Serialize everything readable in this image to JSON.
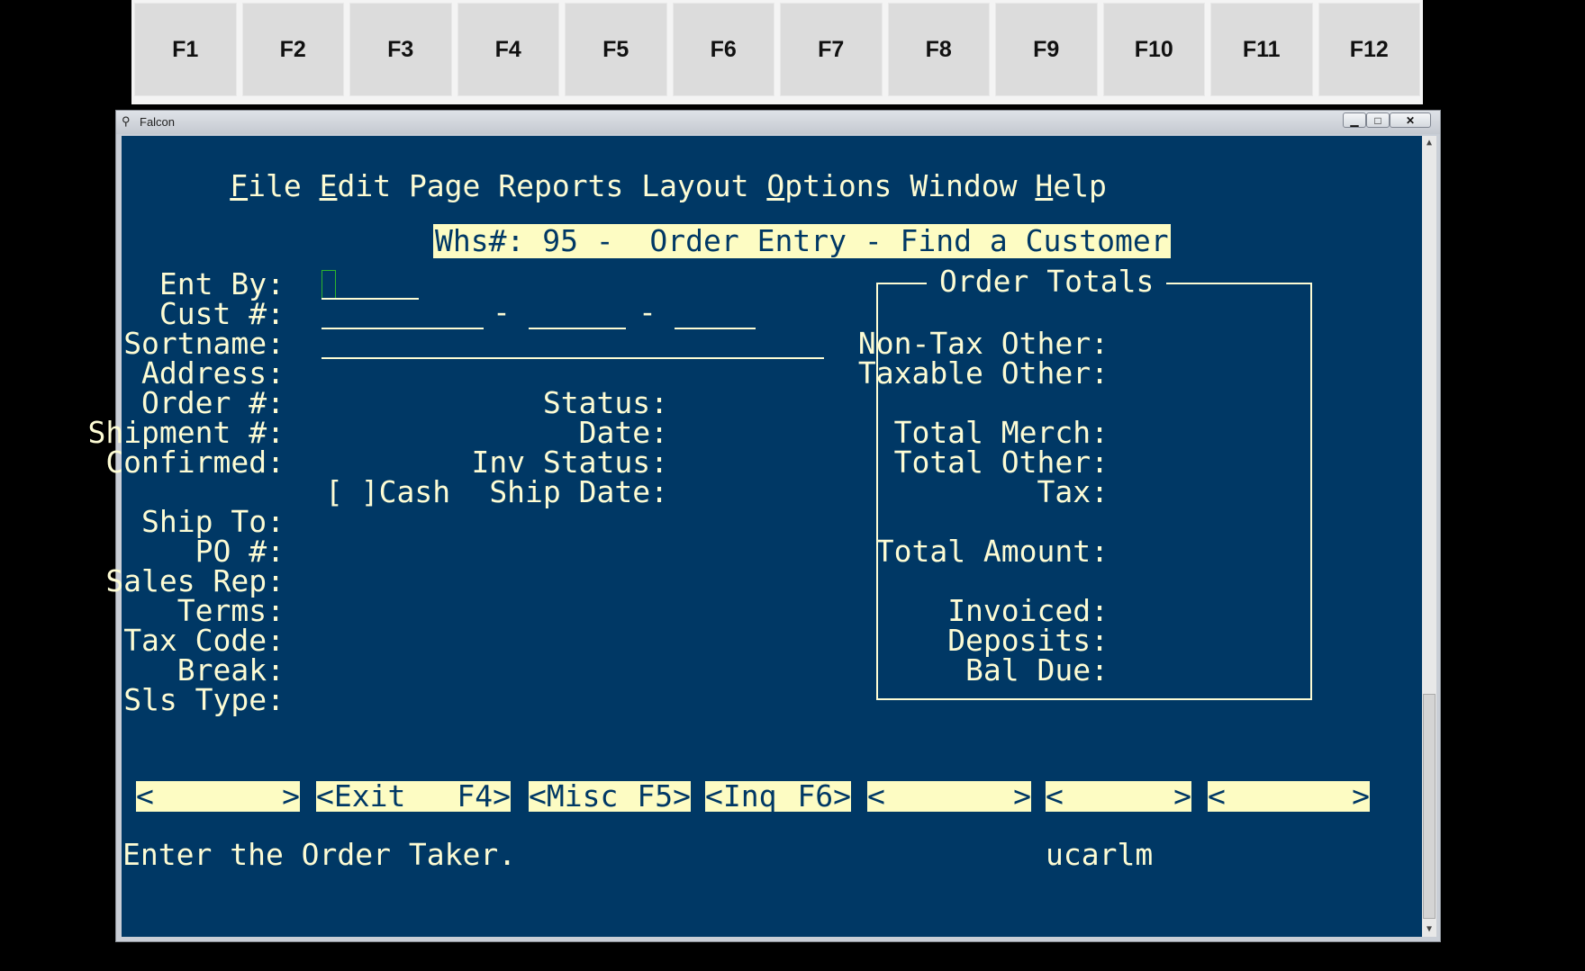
{
  "fkeys": [
    "F1",
    "F2",
    "F3",
    "F4",
    "F5",
    "F6",
    "F7",
    "F8",
    "F9",
    "F10",
    "F11",
    "F12"
  ],
  "window": {
    "title": "Falcon",
    "min": "▁",
    "max": "□",
    "close": "✕"
  },
  "menu": [
    {
      "label": "File",
      "underline": "F",
      "rest": "ile"
    },
    {
      "label": "Edit",
      "underline": "E",
      "rest": "dit"
    },
    {
      "label": "Page"
    },
    {
      "label": "Reports"
    },
    {
      "label": "Layout"
    },
    {
      "label": "Options",
      "underline": "O",
      "rest": "ptions"
    },
    {
      "label": "Window"
    },
    {
      "label": "Help",
      "underline": "H",
      "rest": "elp"
    }
  ],
  "header": "Whs#: 95 -  Order Entry - Find a Customer",
  "labels": {
    "ent_by": "Ent By:",
    "cust": "Cust #:",
    "sortname": "Sortname:",
    "address": "Address:",
    "order": "Order #:",
    "shipment": "Shipment #:",
    "confirmed": "Confirmed:",
    "ship_to": "Ship To:",
    "po": "PO #:",
    "sales_rep": "Sales Rep:",
    "terms": "Terms:",
    "tax_code": "Tax Code:",
    "break": "Break:",
    "sls_type": "Sls Type:",
    "status": "Status:",
    "date": "Date:",
    "inv_status": "Inv Status:",
    "ship_date": "Ship Date:",
    "cash": "[ ]Cash",
    "dash": "-"
  },
  "totals": {
    "title": "Order Totals",
    "non_tax_other": "Non-Tax Other:",
    "taxable_other": "Taxable Other:",
    "total_merch": "Total Merch:",
    "total_other": "Total Other:",
    "tax": "Tax:",
    "total_amount": "Total Amount:",
    "invoiced": "Invoiced:",
    "deposits": "Deposits:",
    "bal_due": "Bal Due:"
  },
  "buttons": [
    {
      "left": "<",
      "right": ">"
    },
    {
      "left": "<Exit",
      "right": "F4>"
    },
    {
      "left": "<Misc",
      "right": "F5>"
    },
    {
      "left": "<Inq",
      "right": "F6>"
    },
    {
      "left": "<",
      "right": ">"
    },
    {
      "left": "<",
      "right": ">"
    },
    {
      "left": "<",
      "right": ">"
    }
  ],
  "status_line": "Enter the Order Taker.",
  "user": "ucarlm",
  "colors": {
    "background": "#003865",
    "text": "#fdfcd4",
    "highlight": "#fdfcc3"
  }
}
